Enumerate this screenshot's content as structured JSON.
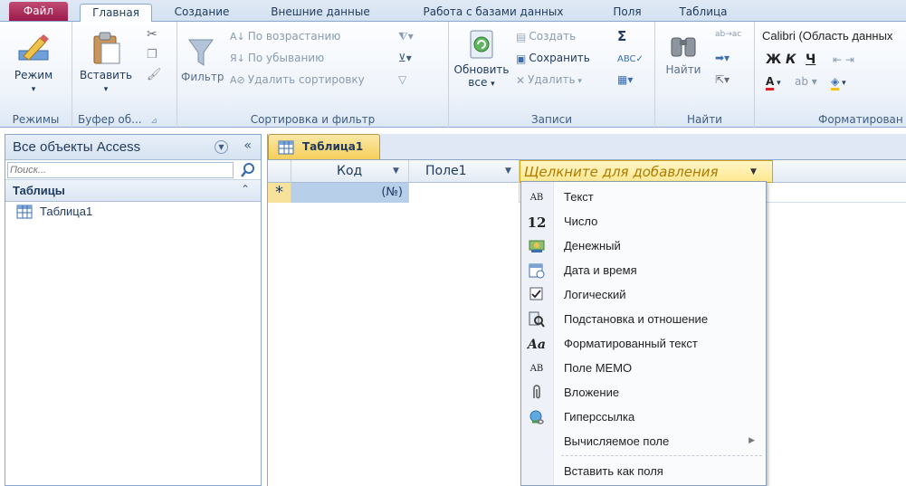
{
  "ribbon_tabs": [
    "Файл",
    "Главная",
    "Создание",
    "Внешние данные",
    "Работа с базами данных",
    "Поля",
    "Таблица"
  ],
  "ribbon": {
    "views": {
      "mode_label": "Режим",
      "group_label": "Режимы"
    },
    "clipboard": {
      "paste_label": "Вставить",
      "group_label": "Буфер об..."
    },
    "sort_filter": {
      "filter_label": "Фильтр",
      "ascending": "По возрастанию",
      "descending": "По убыванию",
      "remove_sort": "Удалить сортировку",
      "group_label": "Сортировка и фильтр"
    },
    "records": {
      "refresh_line1": "Обновить",
      "refresh_line2": "все",
      "create": "Создать",
      "save": "Сохранить",
      "delete": "Удалить",
      "group_label": "Записи"
    },
    "find": {
      "find_label": "Найти",
      "group_label": "Найти"
    },
    "formatting": {
      "font": "Calibri (Область данных",
      "bold": "Ж",
      "italic": "К",
      "underline": "Ч",
      "group_label": "Форматирован"
    }
  },
  "nav_pane": {
    "title": "Все объекты Access",
    "collapse": "«",
    "search_placeholder": "Поиск...",
    "group_name": "Таблицы",
    "items": [
      "Таблица1"
    ]
  },
  "document": {
    "tab_label": "Таблица1",
    "columns": [
      "Код",
      "Поле1",
      "Щелкните для добавления"
    ],
    "new_row_marker": "*",
    "new_row_id": "(№)"
  },
  "field_type_menu": {
    "items": [
      {
        "icon": "AB",
        "label": "Текст"
      },
      {
        "icon": "12",
        "label": "Число"
      },
      {
        "icon": "currency-icon",
        "label": "Денежный"
      },
      {
        "icon": "calendar-icon",
        "label": "Дата и время"
      },
      {
        "icon": "checkbox-icon",
        "label": "Логический"
      },
      {
        "icon": "lookup-icon",
        "label": "Подстановка и отношение"
      },
      {
        "icon": "Aa",
        "label": "Форматированный текст"
      },
      {
        "icon": "AB",
        "label": "Поле MEMO"
      },
      {
        "icon": "paperclip-icon",
        "label": "Вложение"
      },
      {
        "icon": "hyperlink-icon",
        "label": "Гиперссылка"
      },
      {
        "icon": "",
        "label": "Вычисляемое поле"
      },
      {
        "icon": "",
        "label": "Вставить как поля"
      }
    ]
  },
  "colors": {
    "file_tab": "#9a1b4a",
    "doc_tab": "#f5cf5a",
    "add_column_text": "#b07a00",
    "selected_cell": "#b8cfe9"
  }
}
